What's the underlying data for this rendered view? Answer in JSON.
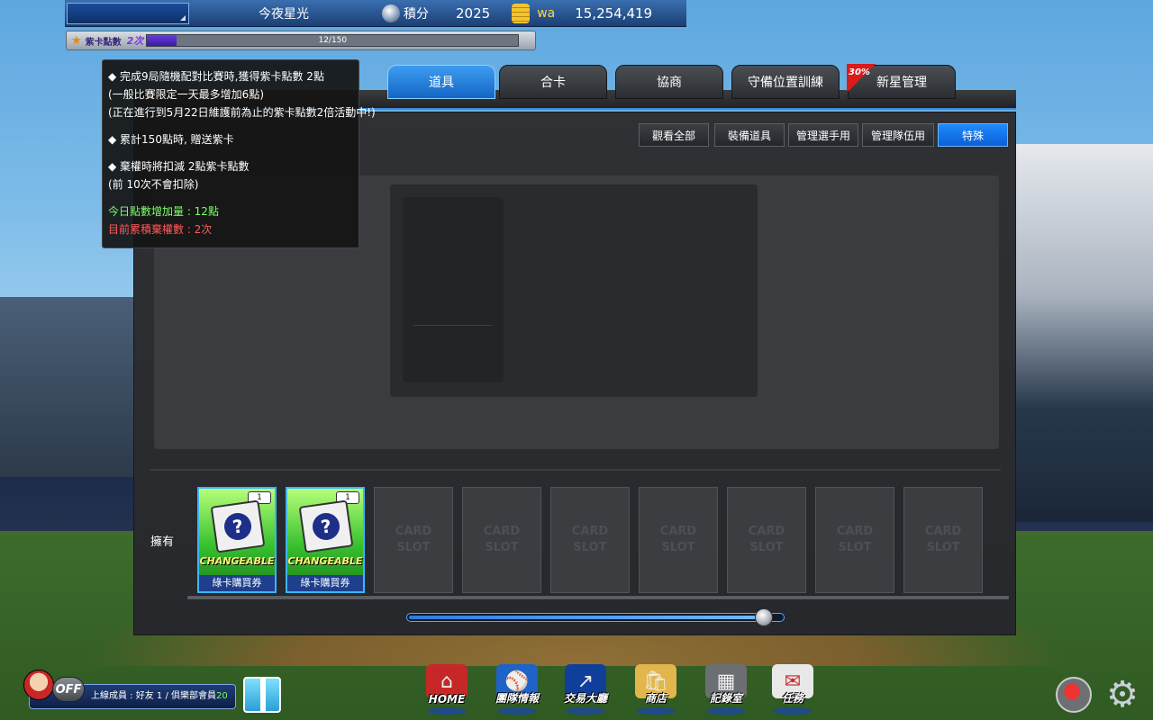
{
  "topbar": {
    "team_name": "今夜星光",
    "points_label": "積分",
    "points_value": "2025",
    "currency_label": "wa",
    "currency_value": "15,254,419"
  },
  "purple_points": {
    "label": "紫卡點數",
    "count": "2次",
    "progress_text": "12/150",
    "progress": 0.08
  },
  "tabs": [
    {
      "label": "道具",
      "active": true
    },
    {
      "label": "合卡",
      "active": false
    },
    {
      "label": "協商",
      "active": false
    },
    {
      "label": "守備位置訓練",
      "active": false
    },
    {
      "label": "新星管理",
      "active": false,
      "badge": "30%"
    }
  ],
  "subtabs": [
    {
      "label": "觀看全部",
      "active": false
    },
    {
      "label": "裝備道具",
      "active": false
    },
    {
      "label": "管理選手用",
      "active": false
    },
    {
      "label": "管理隊伍用",
      "active": false
    },
    {
      "label": "特殊",
      "active": true
    }
  ],
  "tooltip": {
    "line1": "◆ 完成9局隨機配對比賽時,獲得紫卡點數 2點",
    "line2": "(一般比賽限定一天最多增加6點)",
    "line3": "(正在進行到5月22日維護前為止的紫卡點數2倍活動中!)",
    "line4": "◆ 累計150點時, 贈送紫卡",
    "line5": "◆ 棄權時將扣減 2點紫卡點數",
    "line6": "(前 10次不會扣除)",
    "today_points": "今日點數增加量 : 12點",
    "forfeit_count": "目前累積棄權數 : 2次"
  },
  "inventory": {
    "label": "擁有",
    "cards": [
      {
        "tag": "CHANGEABLE",
        "name": "綠卡購買券",
        "count": "1"
      },
      {
        "tag": "CHANGEABLE",
        "name": "綠卡購買券",
        "count": "1"
      }
    ],
    "empty_slot_text": [
      "CARD",
      "SLOT"
    ],
    "empty_slots": 7
  },
  "scroll": {
    "position": 0.97
  },
  "bottom": {
    "status": "OFF",
    "friend_text_prefix": "上線成員 : 好友 ",
    "friend_count": "1",
    "club_text": " / 俱樂部會員",
    "club_count": "20",
    "nav": [
      {
        "label": "HOME",
        "icon": "home-icon"
      },
      {
        "label": "團隊情報",
        "icon": "team-info-icon"
      },
      {
        "label": "交易大廳",
        "icon": "trade-icon"
      },
      {
        "label": "商店",
        "icon": "shop-icon"
      },
      {
        "label": "記錄室",
        "icon": "records-icon"
      },
      {
        "label": "任務",
        "icon": "mission-icon"
      }
    ]
  }
}
